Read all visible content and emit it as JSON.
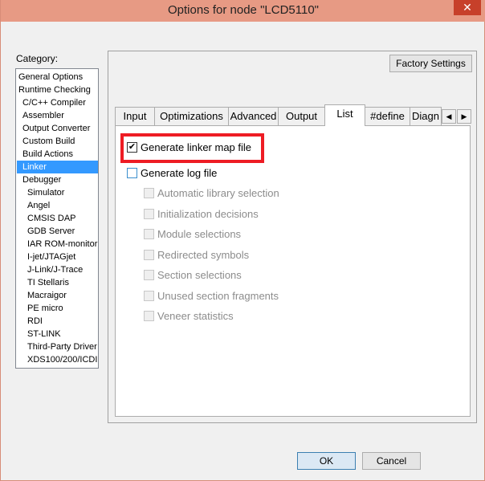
{
  "window": {
    "title": "Options for node \"LCD5110\"",
    "close_glyph": "✕"
  },
  "category": {
    "label": "Category:",
    "selected": "Linker",
    "items": [
      "General Options",
      "Runtime Checking",
      "C/C++ Compiler",
      "Assembler",
      "Output Converter",
      "Custom Build",
      "Build Actions",
      "Linker",
      "Debugger",
      "Simulator",
      "Angel",
      "CMSIS DAP",
      "GDB Server",
      "IAR ROM-monitor",
      "I-jet/JTAGjet",
      "J-Link/J-Trace",
      "TI Stellaris",
      "Macraigor",
      "PE micro",
      "RDI",
      "ST-LINK",
      "Third-Party Driver",
      "XDS100/200/ICDI"
    ]
  },
  "factory_settings_label": "Factory Settings",
  "tabs": [
    "Input",
    "Optimizations",
    "Advanced",
    "Output",
    "List",
    "#define",
    "Diagn"
  ],
  "active_tab": "List",
  "tab_scroll": {
    "left": "◀",
    "right": "▶"
  },
  "options": {
    "generate_map": {
      "label": "Generate linker map file",
      "checked": true,
      "mark": "✔"
    },
    "generate_log": {
      "label": "Generate log file",
      "checked": false
    },
    "log_suboptions": [
      "Automatic library selection",
      "Initialization decisions",
      "Module selections",
      "Redirected symbols",
      "Section selections",
      "Unused section fragments",
      "Veneer statistics"
    ]
  },
  "buttons": {
    "ok": "OK",
    "cancel": "Cancel"
  },
  "colors": {
    "title_bar": "#e79a84",
    "selection": "#3399ff",
    "highlight_box": "#ee1c24"
  }
}
